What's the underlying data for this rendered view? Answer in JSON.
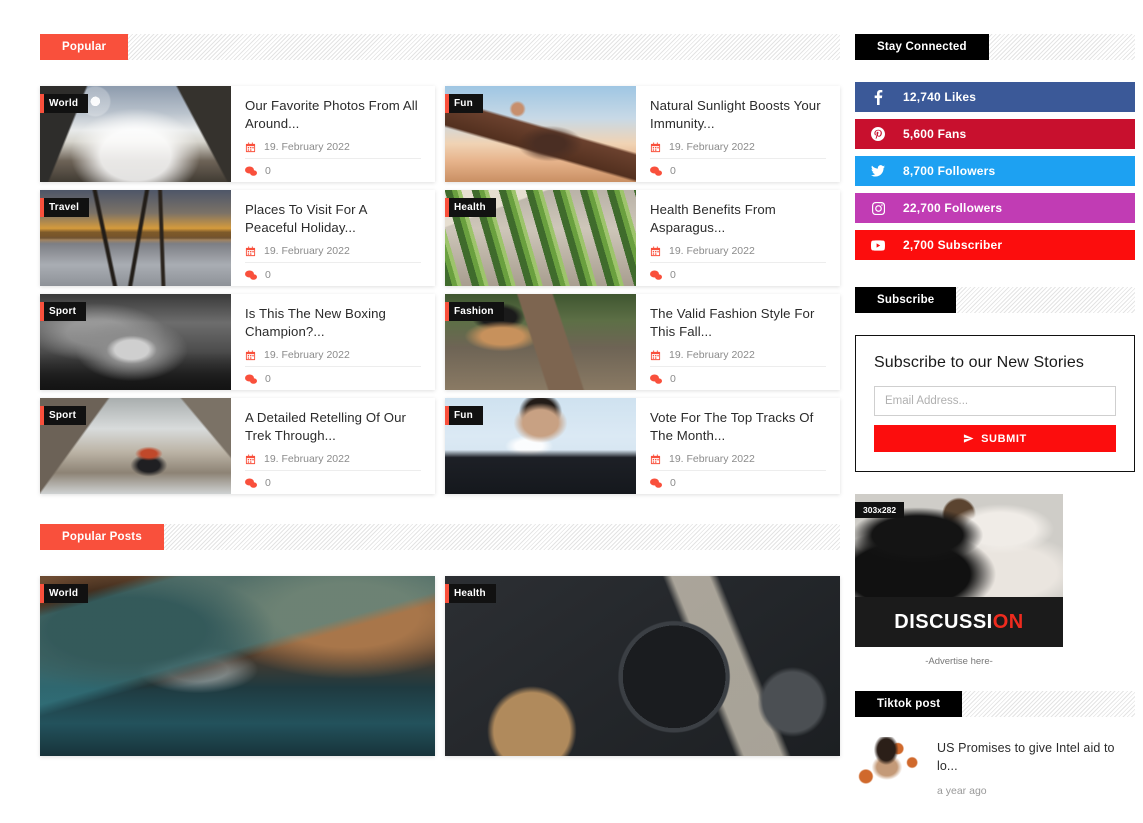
{
  "sections": {
    "popular_label": "Popular",
    "popular_posts_label": "Popular Posts",
    "stay_connected_label": "Stay Connected",
    "subscribe_label": "Subscribe",
    "tiktok_label": "Tiktok post"
  },
  "cards": [
    {
      "category": "World",
      "title": "Our Favorite Photos From All Around...",
      "date": "19. February 2022",
      "comments": "0",
      "photo": "mountain-clouds"
    },
    {
      "category": "Fun",
      "title": "Natural Sunlight Boosts Your Immunity...",
      "date": "19. February 2022",
      "comments": "0",
      "photo": "sunset-girl"
    },
    {
      "category": "Travel",
      "title": "Places To Visit For A Peaceful Holiday...",
      "date": "19. February 2022",
      "comments": "0",
      "photo": "pier-sunset"
    },
    {
      "category": "Health",
      "title": "Health Benefits From Asparagus...",
      "date": "19. February 2022",
      "comments": "0",
      "photo": "asparagus"
    },
    {
      "category": "Sport",
      "title": "Is This The New Boxing Champion?...",
      "date": "19. February 2022",
      "comments": "0",
      "photo": "boxer"
    },
    {
      "category": "Fashion",
      "title": "The Valid Fashion Style For This Fall...",
      "date": "19. February 2022",
      "comments": "0",
      "photo": "fashion-girl"
    },
    {
      "category": "Sport",
      "title": "A Detailed Retelling Of Our Trek Through...",
      "date": "19. February 2022",
      "comments": "0",
      "photo": "trek"
    },
    {
      "category": "Fun",
      "title": "Vote For The Top Tracks Of The Month...",
      "date": "19. February 2022",
      "comments": "0",
      "photo": "singer"
    }
  ],
  "popular_posts": [
    {
      "category": "World",
      "photo": "cave"
    },
    {
      "category": "Health",
      "photo": "breakfast"
    }
  ],
  "social": [
    {
      "network": "facebook",
      "icon": "facebook-icon",
      "label": "12,740 Likes",
      "color": "#3b5998"
    },
    {
      "network": "pinterest",
      "icon": "pinterest-icon",
      "label": "5,600 Fans",
      "color": "#c8102e"
    },
    {
      "network": "twitter",
      "icon": "twitter-icon",
      "label": "8,700 Followers",
      "color": "#1da1f2"
    },
    {
      "network": "instagram",
      "icon": "instagram-icon",
      "label": "22,700 Followers",
      "color": "#c13cb4"
    },
    {
      "network": "youtube",
      "icon": "youtube-icon",
      "label": "2,700 Subscriber",
      "color": "#fc0d0d"
    }
  ],
  "subscribe": {
    "heading": "Subscribe to our New Stories",
    "email_placeholder": "Email Address...",
    "email_value": "",
    "submit_label": "SUBMIT"
  },
  "ad": {
    "size_tag": "303x282",
    "wordmark_main": "DISCUSSI",
    "wordmark_accent": "ON",
    "caption": "-Advertise here-"
  },
  "tiktok": {
    "post_title": "US Promises to give Intel aid to lo...",
    "post_time": "a year ago"
  },
  "colors": {
    "accent_coral": "#f9503c",
    "accent_red": "#fc0d0d",
    "black": "#000000"
  }
}
